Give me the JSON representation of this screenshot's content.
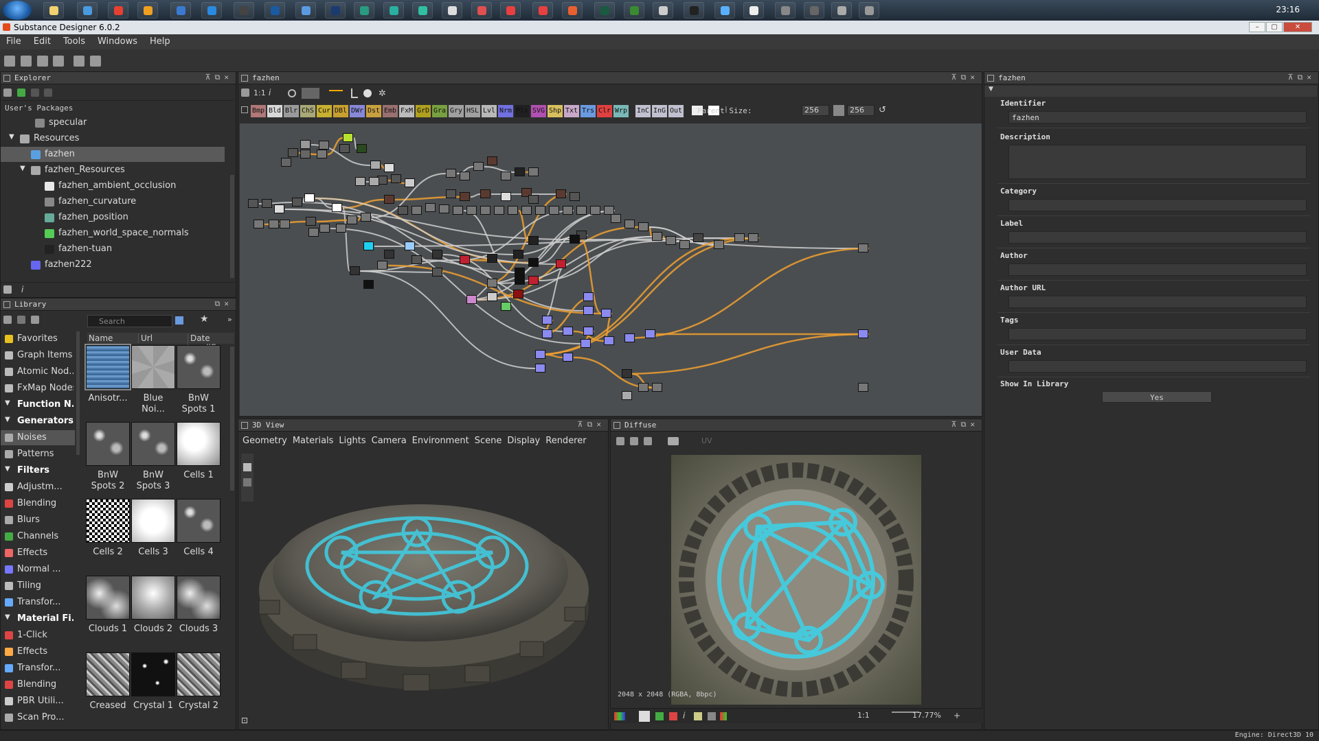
{
  "taskbar": {
    "clock": "23:16"
  },
  "window": {
    "title": "Substance Designer 6.0.2"
  },
  "menu": [
    "File",
    "Edit",
    "Tools",
    "Windows",
    "Help"
  ],
  "explorer": {
    "title": "Explorer",
    "root": "User's Packages",
    "items": [
      {
        "label": "specular",
        "indent": 70,
        "color": "#888"
      },
      {
        "label": "Resources",
        "indent": 48,
        "color": "#aaa",
        "folder": true
      },
      {
        "label": "fazhen",
        "indent": 64,
        "color": "#5aa0e0",
        "selected": true
      },
      {
        "label": "fazhen_Resources",
        "indent": 64,
        "color": "#aaa",
        "folder": true
      },
      {
        "label": "fazhen_ambient_occlusion",
        "indent": 84,
        "color": "#e8e8e8"
      },
      {
        "label": "fazhen_curvature",
        "indent": 84,
        "color": "#888"
      },
      {
        "label": "fazhen_position",
        "indent": 84,
        "color": "#6a9"
      },
      {
        "label": "fazhen_world_space_normals",
        "indent": 84,
        "color": "#5c5"
      },
      {
        "label": "fazhen-tuan",
        "indent": 84,
        "color": "#222"
      },
      {
        "label": "fazhen222",
        "indent": 64,
        "color": "#66e"
      }
    ]
  },
  "library": {
    "title": "Library",
    "search_placeholder": "Search",
    "columns": [
      "Name",
      "Url",
      "Date modifi"
    ],
    "categories": [
      {
        "label": "Favorites",
        "hdr": false,
        "color": "#e8c020"
      },
      {
        "label": "Graph Items",
        "hdr": false,
        "color": "#bbb"
      },
      {
        "label": "Atomic Nod...",
        "hdr": false,
        "color": "#bbb"
      },
      {
        "label": "FxMap Nodes",
        "hdr": false,
        "color": "#bbb"
      },
      {
        "label": "Function N...",
        "hdr": true,
        "color": ""
      },
      {
        "label": "Generators",
        "hdr": true,
        "color": ""
      },
      {
        "label": "Noises",
        "hdr": false,
        "color": "#aaa",
        "selected": true
      },
      {
        "label": "Patterns",
        "hdr": false,
        "color": "#aaa"
      },
      {
        "label": "Filters",
        "hdr": true,
        "color": ""
      },
      {
        "label": "Adjustm...",
        "hdr": false,
        "color": "#ccc"
      },
      {
        "label": "Blending",
        "hdr": false,
        "color": "#d44"
      },
      {
        "label": "Blurs",
        "hdr": false,
        "color": "#aaa"
      },
      {
        "label": "Channels",
        "hdr": false,
        "color": "#4a4"
      },
      {
        "label": "Effects",
        "hdr": false,
        "color": "#e66"
      },
      {
        "label": "Normal ...",
        "hdr": false,
        "color": "#77f"
      },
      {
        "label": "Tiling",
        "hdr": false,
        "color": "#bbb"
      },
      {
        "label": "Transfor...",
        "hdr": false,
        "color": "#6af"
      },
      {
        "label": "Material Fi...",
        "hdr": true,
        "color": ""
      },
      {
        "label": "1-Click",
        "hdr": false,
        "color": "#d44"
      },
      {
        "label": "Effects",
        "hdr": false,
        "color": "#fa4"
      },
      {
        "label": "Transfor...",
        "hdr": false,
        "color": "#6af"
      },
      {
        "label": "Blending",
        "hdr": false,
        "color": "#d44"
      },
      {
        "label": "PBR Utili...",
        "hdr": false,
        "color": "#ccc"
      },
      {
        "label": "Scan Pro...",
        "hdr": false,
        "color": "#aaa"
      }
    ],
    "thumbs": [
      {
        "label": "Anisotr...",
        "style": "aniso"
      },
      {
        "label": "Blue Noi...",
        "style": "noise1"
      },
      {
        "label": "BnW Spots 1",
        "style": "spots"
      },
      {
        "label": "BnW Spots 2",
        "style": "spots"
      },
      {
        "label": "BnW Spots 3",
        "style": "spots"
      },
      {
        "label": "Cells 1",
        "style": "cellsw"
      },
      {
        "label": "Cells 2",
        "style": "cellsbw"
      },
      {
        "label": "Cells 3",
        "style": "cellsw2"
      },
      {
        "label": "Cells 4",
        "style": "spots"
      },
      {
        "label": "Clouds 1",
        "style": "clouds"
      },
      {
        "label": "Clouds 2",
        "style": "clouds2"
      },
      {
        "label": "Clouds 3",
        "style": "clouds"
      },
      {
        "label": "Creased",
        "style": "creased"
      },
      {
        "label": "Crystal 1",
        "style": "crystal"
      },
      {
        "label": "Crystal 2",
        "style": "creased"
      }
    ]
  },
  "graph": {
    "title": "fazhen",
    "zoom": "1:1",
    "filters": [
      {
        "t": "Bmp",
        "c": "#b07878"
      },
      {
        "t": "Bld",
        "c": "#d8d8d8"
      },
      {
        "t": "Blr",
        "c": "#9a9a9a"
      },
      {
        "t": "ChS",
        "c": "#a8a878"
      },
      {
        "t": "Cur",
        "c": "#c8b030"
      },
      {
        "t": "DBl",
        "c": "#c8a030"
      },
      {
        "t": "DWr",
        "c": "#8888d8"
      },
      {
        "t": "Dst",
        "c": "#c8a040"
      },
      {
        "t": "Emb",
        "c": "#9a7070"
      },
      {
        "t": "FxM",
        "c": "#bbbbbb"
      },
      {
        "t": "GrD",
        "c": "#b0a020"
      },
      {
        "t": "Gra",
        "c": "#78a040"
      },
      {
        "t": "Gry",
        "c": "#a0a0a0"
      },
      {
        "t": "HSL",
        "c": "#a0a0a0"
      },
      {
        "t": "Lvl",
        "c": "#b8b8b8"
      },
      {
        "t": "Nrm",
        "c": "#7070e0"
      },
      {
        "t": "Plx",
        "c": "#202020"
      },
      {
        "t": "SVG",
        "c": "#b050b0"
      },
      {
        "t": "Shp",
        "c": "#d8c060"
      },
      {
        "t": "Txt",
        "c": "#c8a8c8"
      },
      {
        "t": "Trs",
        "c": "#6a9ae0"
      },
      {
        "t": "Clr",
        "c": "#e04040"
      },
      {
        "t": "Wrp",
        "c": "#7ab8b8"
      },
      {
        "t": "InC",
        "c": "#c0c0d0"
      },
      {
        "t": "InG",
        "c": "#c0c0d0"
      },
      {
        "t": "Out",
        "c": "#c0c0d0"
      }
    ],
    "parent_size_label": "Parent Size:",
    "size_a": "256",
    "size_b": "256"
  },
  "properties": {
    "title": "fazhen",
    "fields": [
      {
        "label": "Identifier",
        "value": "fazhen",
        "h": 18
      },
      {
        "label": "Description",
        "value": "",
        "h": 50
      },
      {
        "label": "Category",
        "value": "",
        "h": 18
      },
      {
        "label": "Label",
        "value": "",
        "h": 18
      },
      {
        "label": "Author",
        "value": "",
        "h": 18
      },
      {
        "label": "Author URL",
        "value": "",
        "h": 18
      },
      {
        "label": "Tags",
        "value": "",
        "h": 18
      },
      {
        "label": "User Data",
        "value": "",
        "h": 18
      }
    ],
    "show_in_library_label": "Show In Library",
    "show_in_library_value": "Yes"
  },
  "view3d": {
    "title": "3D View",
    "menu": [
      "Geometry",
      "Materials",
      "Lights",
      "Camera",
      "Environment",
      "Scene",
      "Display",
      "Renderer"
    ]
  },
  "view2d": {
    "title": "Diffuse",
    "resolution": "2048 x 2048 (RGBA, 8bpc)",
    "ratio": "1:1",
    "zoom": "17.77%",
    "uv": "UV"
  },
  "status": {
    "engine": "Engine: Direct3D 10"
  }
}
